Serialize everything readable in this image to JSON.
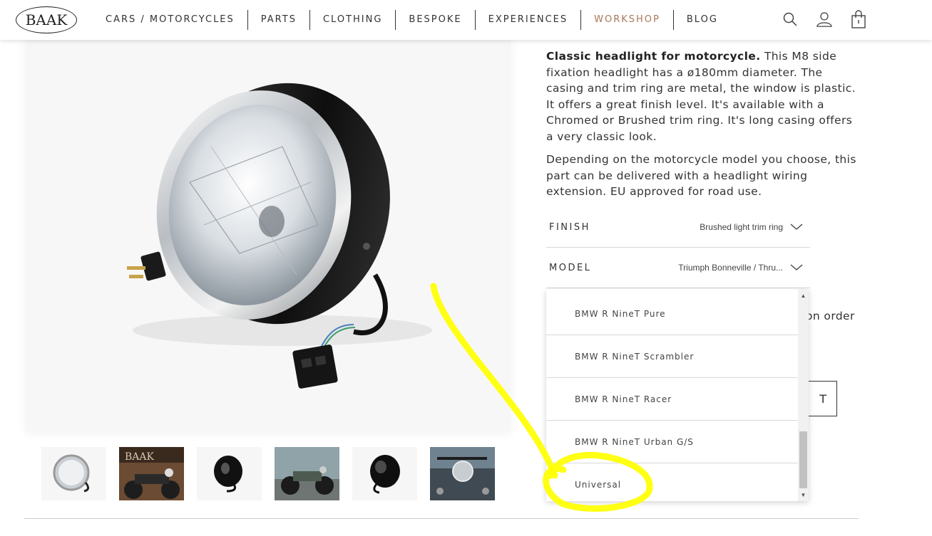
{
  "header": {
    "logo_text": "BAAK",
    "nav": [
      {
        "label": "CARS / MOTORCYCLES"
      },
      {
        "label": "PARTS"
      },
      {
        "label": "CLOTHING"
      },
      {
        "label": "BESPOKE"
      },
      {
        "label": "EXPERIENCES"
      },
      {
        "label": "WORKSHOP"
      },
      {
        "label": "BLOG"
      }
    ],
    "icons": [
      "search-icon",
      "user-icon",
      "shopping-bag-icon"
    ],
    "accent_color": "#a8785a"
  },
  "product": {
    "description_bold": "Classic headlight for motorcycle.",
    "description_rest": " This M8 side fixation headlight has a ø180mm diameter. The casing and trim ring are metal, the window is plastic. It offers a great finish level. It's available with a Chromed or Brushed trim ring. It's long casing offers a very classic look.",
    "description_2": "Depending on the motorcycle model you choose, this part can be delivered with a headlight wiring extension. EU approved for road use.",
    "thumbnail_count": 6
  },
  "options": {
    "finish": {
      "label": "FINISH",
      "value": "Brushed light trim ring"
    },
    "model": {
      "label": "MODEL",
      "value": "Triumph Bonneville / Thru..."
    }
  },
  "model_dropdown": {
    "items": [
      {
        "label": "BMW R NineT Pure"
      },
      {
        "label": "BMW R NineT Scrambler"
      },
      {
        "label": "BMW R NineT Racer"
      },
      {
        "label": "BMW R NineT Urban G/S"
      },
      {
        "label": "Universal"
      }
    ]
  },
  "background_text": {
    "partial_line": "on order",
    "partial_button": "T"
  },
  "annotation_color": "#ffff00"
}
